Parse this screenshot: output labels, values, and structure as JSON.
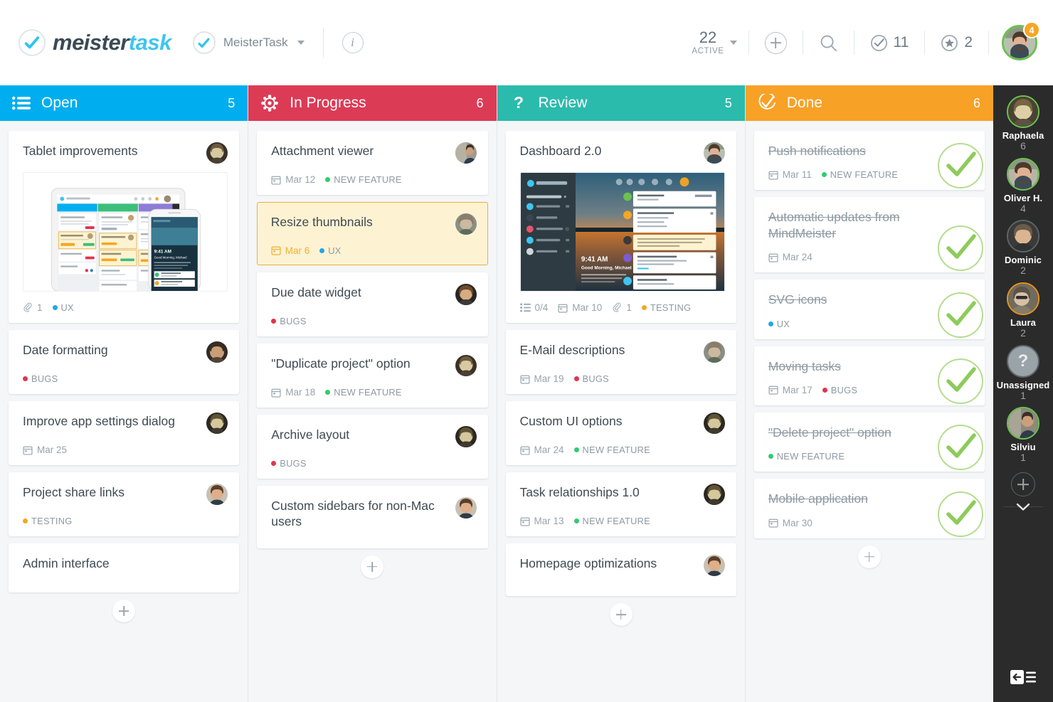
{
  "topbar": {
    "logo_text_1": "meister",
    "logo_text_2": "task",
    "logo_icon": "check-circle-icon",
    "project_name": "MeisterTask",
    "project_icon": "check-circle-icon",
    "dropdown_icon": "caret-down-icon",
    "info_label": "i",
    "active_count": "22",
    "active_label": "ACTIVE",
    "active_caret_icon": "caret-down-icon",
    "add_icon": "plus-circle-icon",
    "search_icon": "search-icon",
    "done_icon": "check-circle-icon",
    "done_count": "11",
    "star_icon": "star-circle-icon",
    "star_count": "2",
    "avatar_icon": "user-avatar",
    "avatar_badge": "4",
    "badge_color": "#F5A623",
    "online_ring_color": "#6BC14E"
  },
  "columns": [
    {
      "id": "open",
      "title": "Open",
      "count": "5",
      "color": "#00AEEF",
      "icon": "list-icon",
      "add_label": "+",
      "cards": [
        {
          "title": "Tablet improvements",
          "avatar": "user-avatar-raphaela",
          "image": "tablet-mockup-preview",
          "meta": [
            {
              "type": "attachment",
              "icon": "paperclip-icon",
              "text": "1"
            }
          ],
          "tags": [
            {
              "label": "UX",
              "color": "#1FA6E8"
            }
          ]
        },
        {
          "title": "Date formatting",
          "avatar": "user-avatar-silviu",
          "meta": [],
          "tags": [
            {
              "label": "BUGS",
              "color": "#E1344F"
            }
          ]
        },
        {
          "title": "Improve app settings dialog",
          "avatar": "user-avatar-laura",
          "meta": [
            {
              "type": "date",
              "icon": "calendar-icon",
              "text": "Mar 25"
            }
          ],
          "tags": []
        },
        {
          "title": "Project share links",
          "avatar": "user-avatar-oliver",
          "meta": [],
          "tags": [
            {
              "label": "TESTING",
              "color": "#F5A623"
            }
          ]
        },
        {
          "title": "Admin interface",
          "avatar": null,
          "meta": [],
          "tags": []
        }
      ]
    },
    {
      "id": "in-progress",
      "title": "In Progress",
      "count": "6",
      "color": "#DC3B55",
      "icon": "gear-icon",
      "add_label": "+",
      "cards": [
        {
          "title": "Attachment viewer",
          "avatar": "user-avatar-silviu",
          "meta": [
            {
              "type": "date",
              "icon": "calendar-icon",
              "text": "Mar 12"
            }
          ],
          "tags": [
            {
              "label": "NEW FEATURE",
              "color": "#2ECC71"
            }
          ]
        },
        {
          "title": "Resize thumbnails",
          "avatar": "user-avatar-dominic",
          "highlighted": true,
          "meta": [
            {
              "type": "date",
              "icon": "calendar-icon",
              "text": "Mar 6",
              "overdue": true
            }
          ],
          "tags": [
            {
              "label": "UX",
              "color": "#1FA6E8"
            }
          ]
        },
        {
          "title": "Due date widget",
          "avatar": "user-avatar-dominic2",
          "meta": [],
          "tags": [
            {
              "label": "BUGS",
              "color": "#E1344F"
            }
          ]
        },
        {
          "title": "\"Duplicate project\" option",
          "avatar": "user-avatar-raphaela",
          "meta": [
            {
              "type": "date",
              "icon": "calendar-icon",
              "text": "Mar 18"
            }
          ],
          "tags": [
            {
              "label": "NEW FEATURE",
              "color": "#2ECC71"
            }
          ]
        },
        {
          "title": "Archive layout",
          "avatar": "user-avatar-raphaela",
          "meta": [],
          "tags": [
            {
              "label": "BUGS",
              "color": "#E1344F"
            }
          ]
        },
        {
          "title": "Custom sidebars for non-Mac users",
          "avatar": "user-avatar-oliver",
          "meta": [],
          "tags": []
        }
      ]
    },
    {
      "id": "review",
      "title": "Review",
      "count": "5",
      "color": "#2BBBAD",
      "icon": "question-mark-icon",
      "add_label": "+",
      "cards": [
        {
          "title": "Dashboard 2.0",
          "avatar": "user-avatar-oliver",
          "image": "dashboard-sunset-preview",
          "meta": [
            {
              "type": "checklist",
              "icon": "checklist-icon",
              "text": "0/4"
            },
            {
              "type": "date",
              "icon": "calendar-icon",
              "text": "Mar 10"
            },
            {
              "type": "attachment",
              "icon": "paperclip-icon",
              "text": "1"
            }
          ],
          "tags": [
            {
              "label": "TESTING",
              "color": "#F5A623"
            }
          ]
        },
        {
          "title": "E-Mail descriptions",
          "avatar": "user-avatar-dominic",
          "meta": [
            {
              "type": "date",
              "icon": "calendar-icon",
              "text": "Mar 19"
            }
          ],
          "tags": [
            {
              "label": "BUGS",
              "color": "#E1344F"
            }
          ]
        },
        {
          "title": "Custom UI options",
          "avatar": "user-avatar-laura",
          "meta": [
            {
              "type": "date",
              "icon": "calendar-icon",
              "text": "Mar 24"
            }
          ],
          "tags": [
            {
              "label": "NEW FEATURE",
              "color": "#2ECC71"
            }
          ]
        },
        {
          "title": "Task relationships 1.0",
          "avatar": "user-avatar-laura",
          "meta": [
            {
              "type": "date",
              "icon": "calendar-icon",
              "text": "Mar 13"
            }
          ],
          "tags": [
            {
              "label": "NEW FEATURE",
              "color": "#2ECC71"
            }
          ]
        },
        {
          "title": "Homepage optimizations",
          "avatar": "user-avatar-oliver",
          "meta": [],
          "tags": []
        }
      ]
    },
    {
      "id": "done",
      "title": "Done",
      "count": "6",
      "color": "#F7A127",
      "icon": "check-circle-icon",
      "add_label": "+",
      "cards": [
        {
          "title": "Push notifications",
          "done": true,
          "meta": [
            {
              "type": "date",
              "icon": "calendar-icon",
              "text": "Mar 11"
            }
          ],
          "tags": [
            {
              "label": "NEW FEATURE",
              "color": "#2ECC71"
            }
          ]
        },
        {
          "title": "Automatic updates from MindMeister",
          "done": true,
          "meta": [
            {
              "type": "date",
              "icon": "calendar-icon",
              "text": "Mar 24"
            }
          ],
          "tags": []
        },
        {
          "title": "SVG icons",
          "done": true,
          "meta": [],
          "tags": [
            {
              "label": "UX",
              "color": "#1FA6E8"
            }
          ]
        },
        {
          "title": "Moving tasks",
          "done": true,
          "meta": [
            {
              "type": "date",
              "icon": "calendar-icon",
              "text": "Mar 17"
            }
          ],
          "tags": [
            {
              "label": "BUGS",
              "color": "#E1344F"
            }
          ]
        },
        {
          "title": "\"Delete project\" option",
          "done": true,
          "meta": [],
          "tags": [
            {
              "label": "NEW FEATURE",
              "color": "#2ECC71"
            }
          ]
        },
        {
          "title": "Mobile application",
          "done": true,
          "meta": [
            {
              "type": "date",
              "icon": "calendar-icon",
              "text": "Mar 30"
            }
          ],
          "tags": []
        }
      ]
    }
  ],
  "rail": {
    "members": [
      {
        "name": "Raphaela",
        "count": "6",
        "status": "online",
        "ring": "#6BC14E"
      },
      {
        "name": "Oliver H.",
        "count": "4",
        "status": "online",
        "ring": "#6BC14E"
      },
      {
        "name": "Dominic",
        "count": "2",
        "status": "offline",
        "ring": "#5D6468"
      },
      {
        "name": "Laura",
        "count": "2",
        "status": "away",
        "ring": "#E8921F"
      },
      {
        "name": "Unassigned",
        "count": "1",
        "status": "none",
        "ring": "#5D6468",
        "glyph": "?"
      },
      {
        "name": "Silviu",
        "count": "1",
        "status": "online",
        "ring": "#6BC14E"
      }
    ],
    "add_member_icon": "plus-circle-icon",
    "expand_icon": "chevron-down-icon",
    "collapse_icon": "collapse-sidebar-icon"
  }
}
